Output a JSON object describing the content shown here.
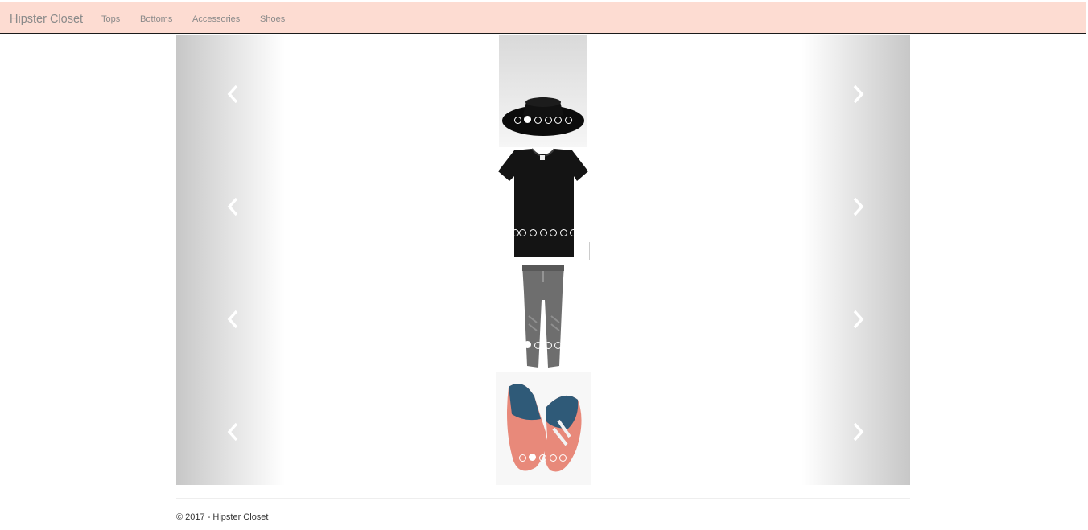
{
  "navbar": {
    "brand": "Hipster Closet",
    "links": [
      "Tops",
      "Bottoms",
      "Accessories",
      "Shoes"
    ],
    "background": "#fddcd2"
  },
  "carousels": [
    {
      "name": "accessories-carousel",
      "item": "hat",
      "indicator_count": 6,
      "active_index": 1
    },
    {
      "name": "tops-carousel",
      "item": "t-shirt",
      "indicator_count": 7,
      "active_index": null
    },
    {
      "name": "bottoms-carousel",
      "item": "jogger-pants",
      "indicator_count": 4,
      "active_index": 0
    },
    {
      "name": "shoes-carousel",
      "item": "sneakers",
      "indicator_count": 5,
      "active_index": 1
    }
  ],
  "controls": {
    "prev_icon": "chevron-left-icon",
    "next_icon": "chevron-right-icon"
  },
  "footer": {
    "text": "© 2017 - Hipster Closet"
  }
}
